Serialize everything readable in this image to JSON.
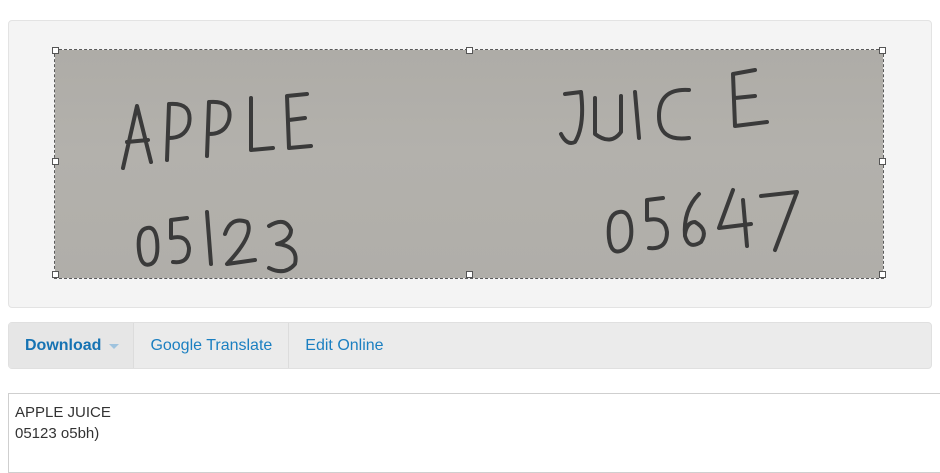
{
  "image": {
    "handwriting_lines": [
      "APPLE",
      "05123",
      "JUICE",
      "05647"
    ]
  },
  "toolbar": {
    "download_label": "Download",
    "translate_label": "Google Translate",
    "edit_label": "Edit Online"
  },
  "result": {
    "text": "APPLE JUICE\n05123 o5bh)"
  }
}
